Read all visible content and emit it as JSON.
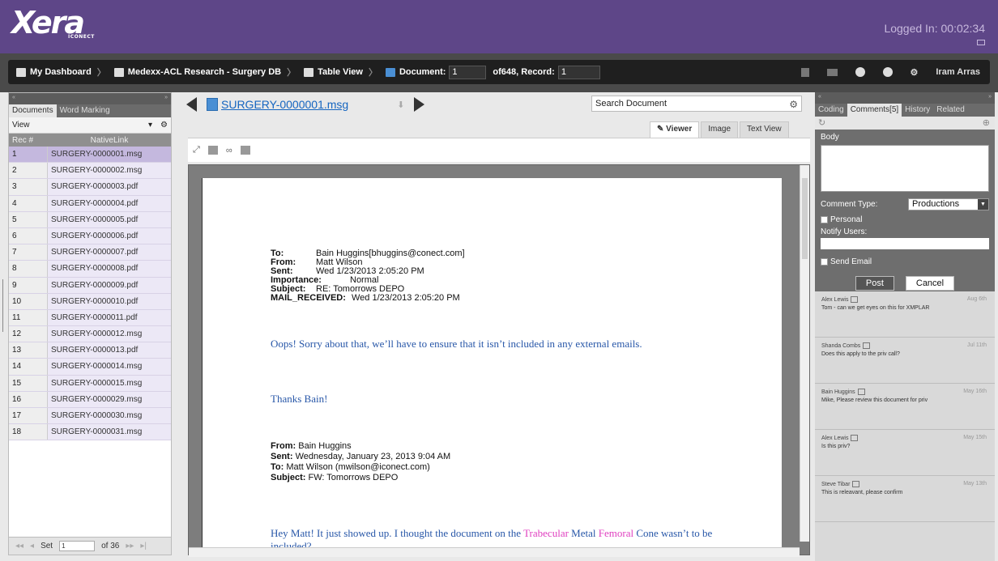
{
  "app": {
    "logo_text": "Xera",
    "logo_sub": "ICONECT",
    "logged_in": "Logged In: 00:02:34"
  },
  "breadcrumb": {
    "dashboard": "My Dashboard",
    "database": "Medexx-ACL Research - Surgery DB",
    "table_view": "Table View",
    "document_label": "Document:",
    "document_value": "1",
    "of_record_label": "of648, Record:",
    "record_value": "1"
  },
  "user": {
    "name": "Iram Arras"
  },
  "left_panel": {
    "collapse": "«",
    "expand": "»",
    "tabs": [
      "Documents",
      "Word Marking"
    ],
    "view_label": "View",
    "columns": [
      "Rec #",
      "NativeLink"
    ],
    "rows": [
      {
        "rec": "1",
        "link": "SURGERY-0000001.msg"
      },
      {
        "rec": "2",
        "link": "SURGERY-0000002.msg"
      },
      {
        "rec": "3",
        "link": "SURGERY-0000003.pdf"
      },
      {
        "rec": "4",
        "link": "SURGERY-0000004.pdf"
      },
      {
        "rec": "5",
        "link": "SURGERY-0000005.pdf"
      },
      {
        "rec": "6",
        "link": "SURGERY-0000006.pdf"
      },
      {
        "rec": "7",
        "link": "SURGERY-0000007.pdf"
      },
      {
        "rec": "8",
        "link": "SURGERY-0000008.pdf"
      },
      {
        "rec": "9",
        "link": "SURGERY-0000009.pdf"
      },
      {
        "rec": "10",
        "link": "SURGERY-0000010.pdf"
      },
      {
        "rec": "11",
        "link": "SURGERY-0000011.pdf"
      },
      {
        "rec": "12",
        "link": "SURGERY-0000012.msg"
      },
      {
        "rec": "13",
        "link": "SURGERY-0000013.pdf"
      },
      {
        "rec": "14",
        "link": "SURGERY-0000014.msg"
      },
      {
        "rec": "15",
        "link": "SURGERY-0000015.msg"
      },
      {
        "rec": "16",
        "link": "SURGERY-0000029.msg"
      },
      {
        "rec": "17",
        "link": "SURGERY-0000030.msg"
      },
      {
        "rec": "18",
        "link": "SURGERY-0000031.msg"
      }
    ],
    "footer": {
      "set_label": "Set",
      "set_value": "1",
      "of_sets": "of 36"
    }
  },
  "viewer": {
    "doc_title": "SURGERY-0000001.msg",
    "search_placeholder": "Search Document",
    "tabs": [
      "Viewer",
      "Image",
      "Text View"
    ],
    "email": {
      "to_k": "To:",
      "to_v": "Bain Huggins[bhuggins@conect.com]",
      "from_k": "From:",
      "from_v": "Matt Wilson",
      "sent_k": "Sent:",
      "sent_v": "Wed 1/23/2013 2:05:20 PM",
      "imp_k": "Importance:",
      "imp_v": "Normal",
      "subj_k": "Subject:",
      "subj_v": "RE: Tomorrows DEPO",
      "rec_k": "MAIL_RECEIVED:",
      "rec_v": "Wed 1/23/2013 2:05:20 PM",
      "para1": "Oops!  Sorry about that, we’ll have to ensure that it isn’t included in any external emails.",
      "para2": "Thanks Bain!",
      "fwd_from_k": "From:",
      "fwd_from_v": "Bain Huggins",
      "fwd_sent_k": "Sent:",
      "fwd_sent_v": "Wednesday, January 23, 2013 9:04 AM",
      "fwd_to_k": "To:",
      "fwd_to_v": "Matt Wilson (mwilson@iconect.com)",
      "fwd_subj_k": "Subject:",
      "fwd_subj_v": "FW: Tomorrows DEPO",
      "para3_a": "Hey Matt!  It just showed up.  I thought the document on the ",
      "para3_hl1": "Trabecular",
      "para3_b": " Metal ",
      "para3_hl2": "Femoral",
      "para3_c": " Cone wasn’t to be included?"
    }
  },
  "right_panel": {
    "collapse": "«",
    "expand": "»",
    "tabs": [
      "Coding",
      "Comments[5]",
      "History",
      "Related"
    ],
    "body_label": "Body",
    "comment_type_label": "Comment Type:",
    "comment_type_value": "Productions",
    "personal_label": "Personal",
    "notify_label": "Notify Users:",
    "send_email_label": "Send Email",
    "post_label": "Post",
    "cancel_label": "Cancel",
    "comments": [
      {
        "who": "Alex Lewis",
        "date": "Aug 6th",
        "msg": "Tom - can we get eyes on this for XMPLAR"
      },
      {
        "who": "Shanda Combs",
        "date": "Jul 11th",
        "msg": "Does this apply to the priv call?"
      },
      {
        "who": "Bain Huggins",
        "date": "May 16th",
        "msg": "Mike, Please review this document for priv"
      },
      {
        "who": "Alex Lewis",
        "date": "May 15th",
        "msg": "Is this priv?"
      },
      {
        "who": "Steve Tibar",
        "date": "May 13th",
        "msg": "This is releavant, please confirm"
      }
    ]
  },
  "colors": {
    "brand": "#5e4688",
    "nav": "#1f1f1f",
    "link": "#1565c0",
    "highlight": "#e040c0"
  }
}
